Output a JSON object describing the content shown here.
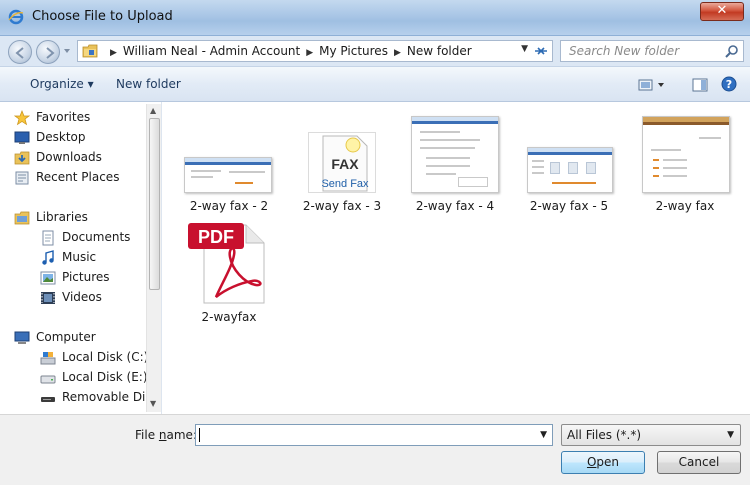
{
  "window": {
    "title": "Choose File to Upload",
    "close_label": "✕"
  },
  "address": {
    "crumbs": [
      "William Neal - Admin Account",
      "My Pictures",
      "New folder"
    ],
    "search_placeholder": "Search New folder"
  },
  "toolbar": {
    "organize_label": "Organize ▾",
    "new_folder_label": "New folder"
  },
  "nav": {
    "favorites": {
      "label": "Favorites",
      "items": [
        "Desktop",
        "Downloads",
        "Recent Places"
      ]
    },
    "libraries": {
      "label": "Libraries",
      "items": [
        "Documents",
        "Music",
        "Pictures",
        "Videos"
      ]
    },
    "computer": {
      "label": "Computer",
      "items": [
        "Local Disk (C:)",
        "Local Disk (E:)",
        "Removable Disk ("
      ]
    }
  },
  "files": [
    {
      "name": "2-way fax - 2",
      "kind": "screenshot"
    },
    {
      "name": "2-way fax - 3",
      "kind": "fax-icon",
      "icon_text": "FAX",
      "icon_caption": "Send Fax"
    },
    {
      "name": "2-way fax - 4",
      "kind": "screenshot"
    },
    {
      "name": "2-way fax - 5",
      "kind": "screenshot"
    },
    {
      "name": "2-way fax",
      "kind": "screenshot"
    },
    {
      "name": "2-wayfax",
      "kind": "pdf",
      "icon_text": "PDF"
    }
  ],
  "bottom": {
    "file_name_label_prefix": "File ",
    "file_name_label_accel": "n",
    "file_name_label_suffix": "ame:",
    "file_name_value": "",
    "file_type_value": "All Files (*.*)",
    "open_accel": "O",
    "open_rest": "pen",
    "cancel_label": "Cancel"
  },
  "colors": {
    "title_gradient": "#a9c6e6",
    "close_button": "#c23a22",
    "pdf_red": "#c8102e",
    "accent_blue": "#3b6fb6"
  }
}
